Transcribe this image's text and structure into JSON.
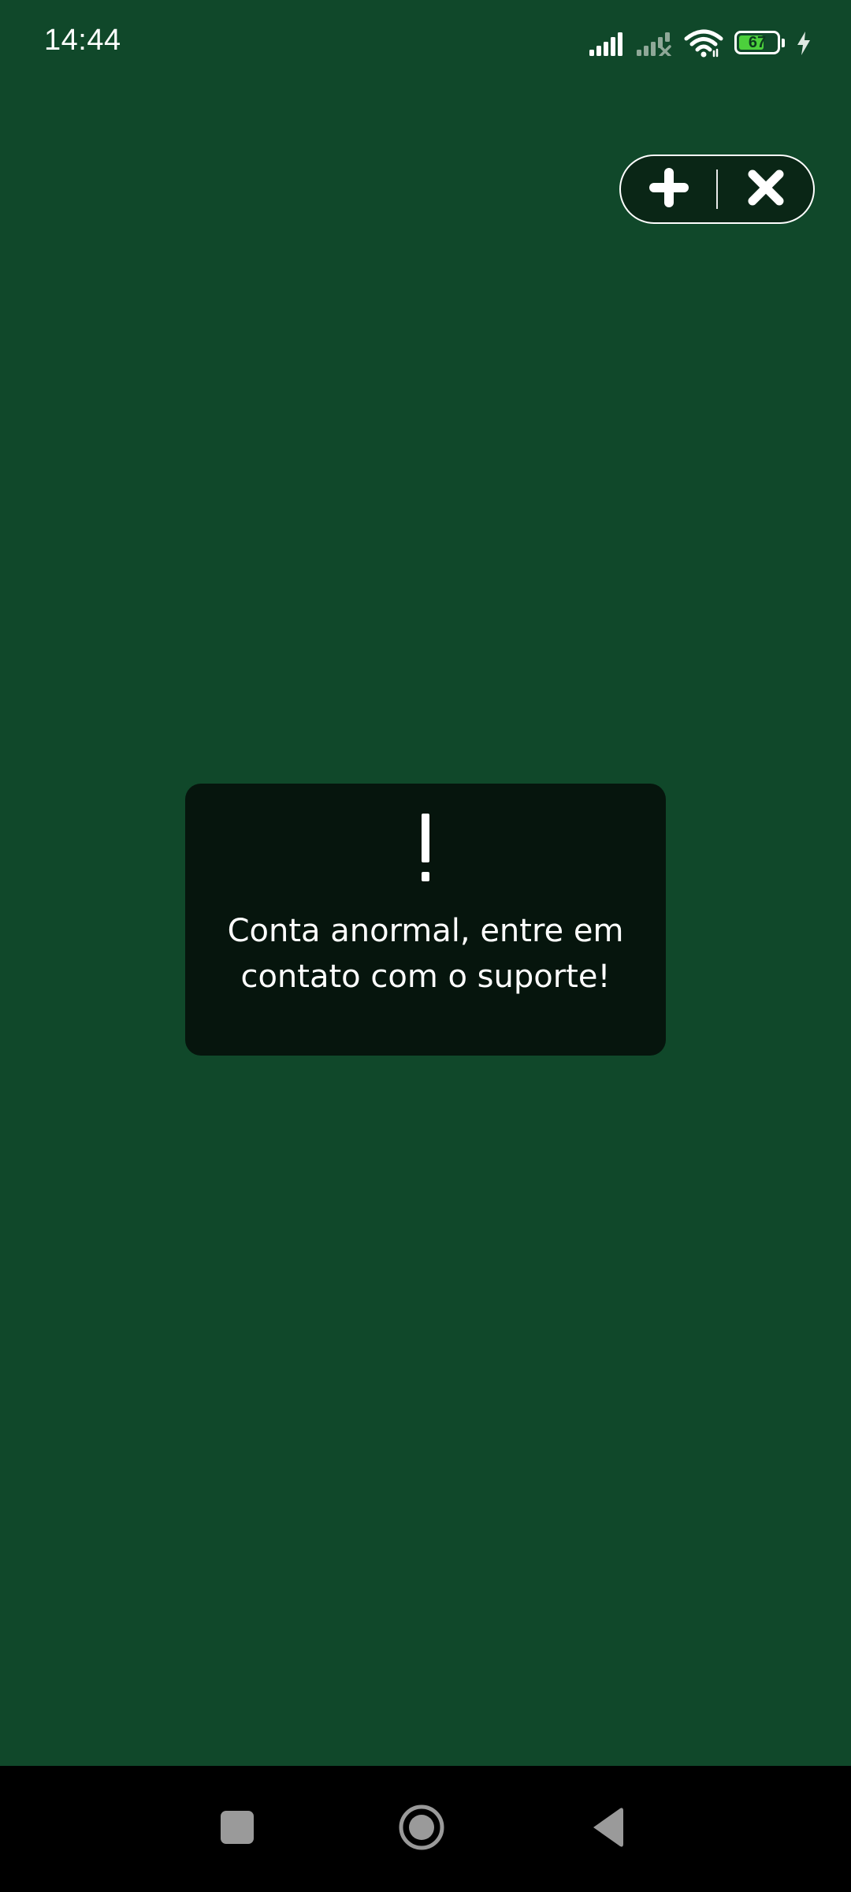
{
  "status_bar": {
    "time": "14:44",
    "battery_level": "67",
    "battery_fraction": 0.67,
    "icons": [
      "signal-strength-icon",
      "signal-no-service-icon",
      "wifi-icon",
      "battery-icon",
      "charging-icon"
    ]
  },
  "mini_program_capsule": {
    "icons": [
      "plus-icon",
      "close-icon"
    ]
  },
  "toast": {
    "icon": "exclamation-icon",
    "message": "Conta anormal, entre em contato com o suporte!"
  },
  "navigation_bar": {
    "icons": [
      "recent-apps-icon",
      "home-icon",
      "back-icon"
    ]
  },
  "colors": {
    "background": "#10482a",
    "toast_background": "#06150d",
    "battery_fill": "#4cd03c",
    "nav_bar": "#000000"
  }
}
